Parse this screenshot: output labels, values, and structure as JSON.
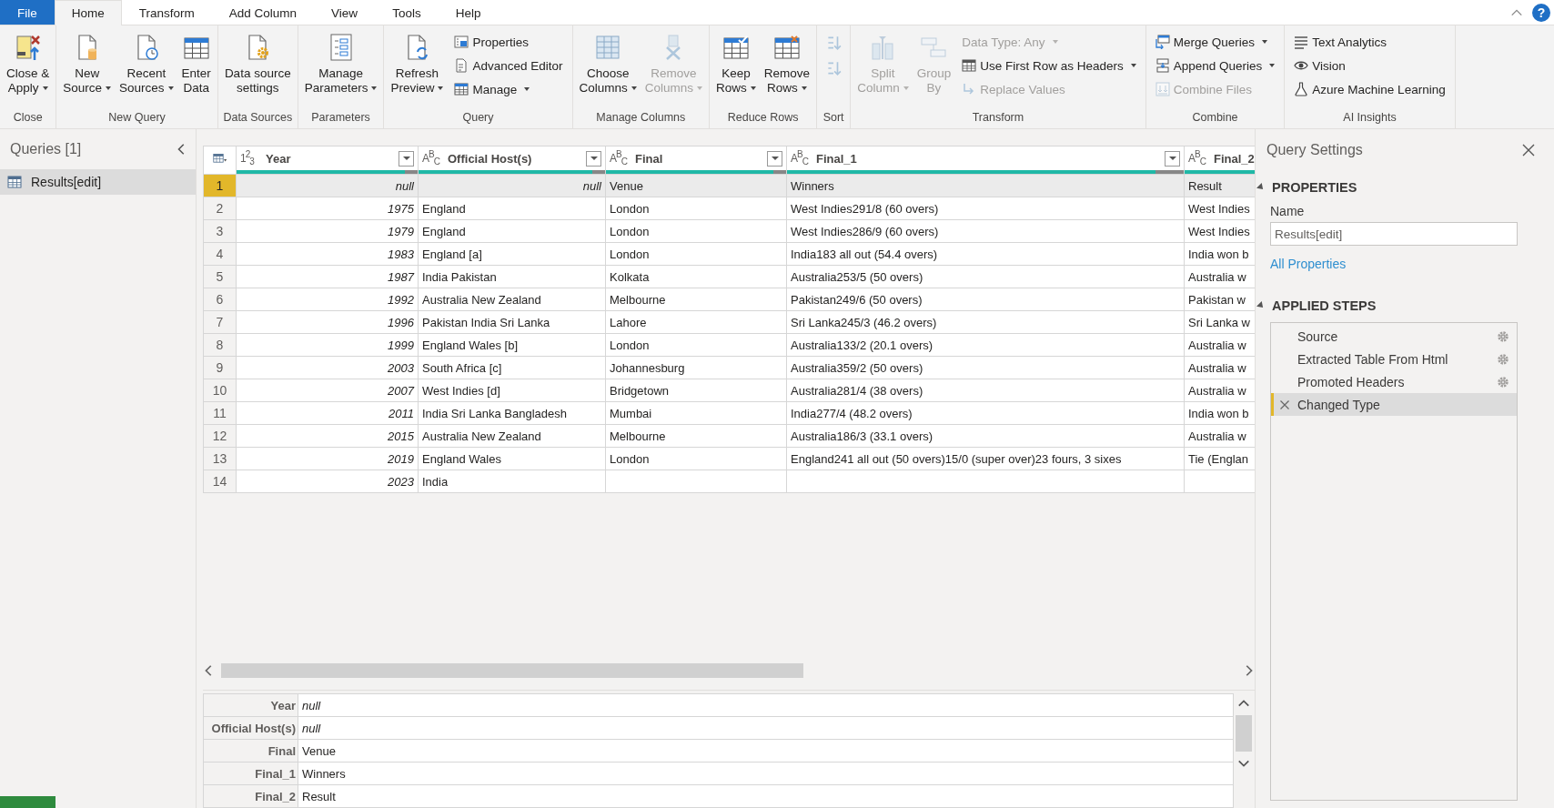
{
  "tabs": [
    {
      "label": "File",
      "kind": "file",
      "selected": false
    },
    {
      "label": "Home",
      "kind": "tab",
      "selected": true
    },
    {
      "label": "Transform",
      "kind": "tab",
      "selected": false
    },
    {
      "label": "Add Column",
      "kind": "tab",
      "selected": false
    },
    {
      "label": "View",
      "kind": "tab",
      "selected": false
    },
    {
      "label": "Tools",
      "kind": "tab",
      "selected": false
    },
    {
      "label": "Help",
      "kind": "tab",
      "selected": false
    }
  ],
  "help": "?",
  "ribbon": {
    "groups": [
      {
        "label": "Close",
        "items": [
          {
            "kind": "large",
            "label": "Close &\nApply",
            "dropdown": true,
            "disabled": false
          }
        ]
      },
      {
        "label": "New Query",
        "items": [
          {
            "kind": "large",
            "label": "New\nSource",
            "dropdown": true,
            "disabled": false
          },
          {
            "kind": "large",
            "label": "Recent\nSources",
            "dropdown": true,
            "disabled": false
          },
          {
            "kind": "large",
            "label": "Enter\nData",
            "dropdown": false,
            "disabled": false
          }
        ]
      },
      {
        "label": "Data Sources",
        "items": [
          {
            "kind": "large",
            "label": "Data source\nsettings",
            "dropdown": false,
            "disabled": false
          }
        ]
      },
      {
        "label": "Parameters",
        "items": [
          {
            "kind": "large",
            "label": "Manage\nParameters",
            "dropdown": true,
            "disabled": false
          }
        ]
      },
      {
        "label": "Query",
        "items": [
          {
            "kind": "large",
            "label": "Refresh\nPreview",
            "dropdown": true,
            "disabled": false
          },
          {
            "kind": "stack",
            "items": [
              {
                "label": "Properties",
                "icon": true,
                "dropdown": false,
                "disabled": false
              },
              {
                "label": "Advanced Editor",
                "icon": true,
                "dropdown": false,
                "disabled": false
              },
              {
                "label": "Manage",
                "icon": true,
                "dropdown": true,
                "disabled": false
              }
            ]
          }
        ]
      },
      {
        "label": "Manage Columns",
        "items": [
          {
            "kind": "large",
            "label": "Choose\nColumns",
            "dropdown": true,
            "disabled": false
          },
          {
            "kind": "large",
            "label": "Remove\nColumns",
            "dropdown": true,
            "disabled": true
          }
        ]
      },
      {
        "label": "Reduce Rows",
        "items": [
          {
            "kind": "large",
            "label": "Keep\nRows",
            "dropdown": true,
            "disabled": false
          },
          {
            "kind": "large",
            "label": "Remove\nRows",
            "dropdown": true,
            "disabled": false
          }
        ]
      },
      {
        "label": "Sort",
        "items": [
          {
            "kind": "iconstack",
            "items": [
              {
                "disabled": true
              },
              {
                "disabled": true
              }
            ]
          }
        ]
      },
      {
        "label": "Transform",
        "items": [
          {
            "kind": "large",
            "label": "Split\nColumn",
            "dropdown": true,
            "disabled": true
          },
          {
            "kind": "large",
            "label": "Group\nBy",
            "dropdown": false,
            "disabled": true
          },
          {
            "kind": "stack",
            "items": [
              {
                "label": "Data Type: Any",
                "icon": false,
                "dropdown": true,
                "disabled": true
              },
              {
                "label": "Use First Row as Headers",
                "icon": true,
                "dropdown": true,
                "disabled": false
              },
              {
                "label": "Replace Values",
                "icon": true,
                "dropdown": false,
                "disabled": true
              }
            ]
          }
        ]
      },
      {
        "label": "Combine",
        "items": [
          {
            "kind": "stack",
            "items": [
              {
                "label": "Merge Queries",
                "icon": true,
                "dropdown": true,
                "disabled": false
              },
              {
                "label": "Append Queries",
                "icon": true,
                "dropdown": true,
                "disabled": false
              },
              {
                "label": "Combine Files",
                "icon": true,
                "dropdown": false,
                "disabled": true
              }
            ]
          }
        ]
      },
      {
        "label": "AI Insights",
        "items": [
          {
            "kind": "stack",
            "items": [
              {
                "label": "Text Analytics",
                "icon": true,
                "dropdown": false,
                "disabled": false
              },
              {
                "label": "Vision",
                "icon": true,
                "dropdown": false,
                "disabled": false
              },
              {
                "label": "Azure Machine Learning",
                "icon": true,
                "dropdown": false,
                "disabled": false
              }
            ]
          }
        ]
      }
    ]
  },
  "queries": {
    "title": "Queries [1]",
    "items": [
      {
        "label": "Results[edit]",
        "selected": true
      }
    ]
  },
  "grid": {
    "columns": [
      {
        "type": "1$^{2}$$_{3}$",
        "name": "Year",
        "kind": "number",
        "filter": true,
        "level": 0.93
      },
      {
        "type": "A$^{B}$$_{C}$",
        "name": "Official Host(s)",
        "kind": "text",
        "filter": true,
        "level": 0.93
      },
      {
        "type": "A$^{B}$$_{C}$",
        "name": "Final",
        "kind": "text",
        "filter": true,
        "level": 0.93
      },
      {
        "type": "A$^{B}$$_{C}$",
        "name": "Final_1",
        "kind": "text",
        "filter": true,
        "level": 0.93
      },
      {
        "type": "A$^{B}$$_{C}$",
        "name": "Final_2",
        "kind": "text",
        "level": 1
      }
    ],
    "rows": [
      {
        "number": "1",
        "selected": true,
        "cells": [
          {
            "text": "null",
            "kind": "null"
          },
          {
            "text": "null",
            "kind": "null"
          },
          "Venue",
          "Winners",
          "Result"
        ]
      },
      {
        "number": "2",
        "selected": false,
        "cells": [
          "1975",
          "England",
          "London",
          "West Indies291/8 (60 overs)",
          "West Indies"
        ]
      },
      {
        "number": "3",
        "selected": false,
        "cells": [
          "1979",
          "England",
          "London",
          "West Indies286/9 (60 overs)",
          "West Indies"
        ]
      },
      {
        "number": "4",
        "selected": false,
        "cells": [
          "1983",
          "England [a]",
          "London",
          "India183 all out (54.4 overs)",
          "India won b"
        ]
      },
      {
        "number": "5",
        "selected": false,
        "cells": [
          "1987",
          "India Pakistan",
          "Kolkata",
          "Australia253/5 (50 overs)",
          "Australia w"
        ]
      },
      {
        "number": "6",
        "selected": false,
        "cells": [
          "1992",
          "Australia New Zealand",
          "Melbourne",
          "Pakistan249/6 (50 overs)",
          "Pakistan w"
        ]
      },
      {
        "number": "7",
        "selected": false,
        "cells": [
          "1996",
          "Pakistan India Sri Lanka",
          "Lahore",
          "Sri Lanka245/3 (46.2 overs)",
          "Sri Lanka w"
        ]
      },
      {
        "number": "8",
        "selected": false,
        "cells": [
          "1999",
          "England Wales [b]",
          "London",
          "Australia133/2 (20.1 overs)",
          "Australia w"
        ]
      },
      {
        "number": "9",
        "selected": false,
        "cells": [
          "2003",
          "South Africa [c]",
          "Johannesburg",
          "Australia359/2 (50 overs)",
          "Australia w"
        ]
      },
      {
        "number": "10",
        "selected": false,
        "cells": [
          "2007",
          "West Indies [d]",
          "Bridgetown",
          "Australia281/4 (38 overs)",
          "Australia w"
        ]
      },
      {
        "number": "11",
        "selected": false,
        "cells": [
          "2011",
          "India Sri Lanka Bangladesh",
          "Mumbai",
          "India277/4 (48.2 overs)",
          "India won b"
        ]
      },
      {
        "number": "12",
        "selected": false,
        "cells": [
          "2015",
          "Australia New Zealand",
          "Melbourne",
          "Australia186/3 (33.1 overs)",
          "Australia w"
        ]
      },
      {
        "number": "13",
        "selected": false,
        "cells": [
          "2019",
          "England Wales",
          "London",
          "England241 all out (50 overs)15/0 (super over)23 fours, 3 sixes",
          "Tie (Englan"
        ]
      },
      {
        "number": "14",
        "selected": false,
        "cells": [
          "2023",
          "India",
          null,
          null,
          null
        ]
      }
    ]
  },
  "details": {
    "rows": [
      {
        "label": "Year",
        "value": "null",
        "kind": "null"
      },
      {
        "label": "Official Host(s)",
        "value": "null",
        "kind": "null"
      },
      {
        "label": "Final",
        "value": "Venue",
        "kind": "text"
      },
      {
        "label": "Final_1",
        "value": "Winners",
        "kind": "text"
      },
      {
        "label": "Final_2",
        "value": "Result",
        "kind": "text"
      }
    ]
  },
  "settings": {
    "title": "Query Settings",
    "properties": {
      "heading": "PROPERTIES",
      "expanded": true,
      "name_label": "Name",
      "name_value": "Results[edit]",
      "link": "All Properties"
    },
    "applied_steps": {
      "heading": "APPLIED STEPS",
      "expanded": true,
      "steps": [
        {
          "name": "Source",
          "settings": true,
          "selected": false
        },
        {
          "name": "Extracted Table From Html",
          "settings": true,
          "selected": false
        },
        {
          "name": "Promoted Headers",
          "settings": true,
          "selected": false
        },
        {
          "name": "Changed Type",
          "settings": false,
          "selected": true
        }
      ]
    }
  }
}
